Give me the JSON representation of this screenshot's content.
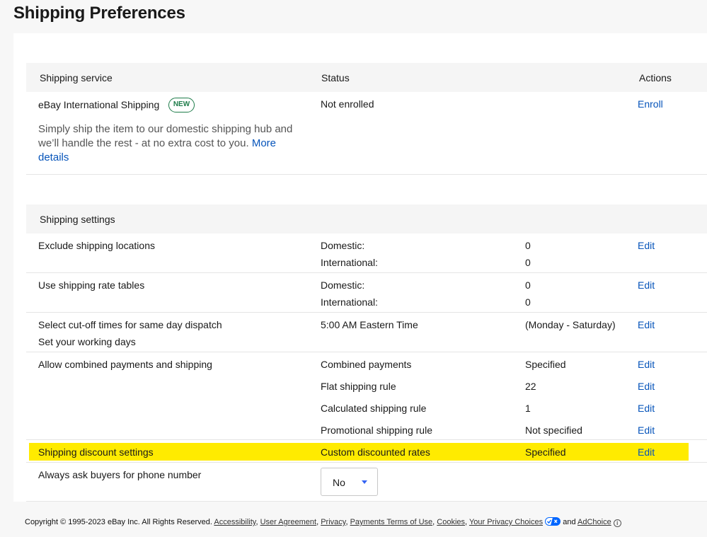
{
  "page": {
    "title": "Shipping Preferences"
  },
  "service_table": {
    "headers": {
      "service": "Shipping service",
      "status": "Status",
      "actions": "Actions"
    },
    "row": {
      "name": "eBay International Shipping",
      "badge": "NEW",
      "description": "Simply ship the item to our domestic shipping hub and we’ll handle the rest - at no extra cost to you.",
      "more_link": "More details",
      "status": "Not enrolled",
      "action": "Enroll"
    }
  },
  "settings": {
    "header": "Shipping settings",
    "exclude": {
      "label": "Exclude shipping locations",
      "domestic_label": "Domestic:",
      "domestic_value": "0",
      "international_label": "International:",
      "international_value": "0",
      "action": "Edit"
    },
    "rate_tables": {
      "label": "Use shipping rate tables",
      "domestic_label": "Domestic:",
      "domestic_value": "0",
      "international_label": "International:",
      "international_value": "0",
      "action": "Edit"
    },
    "cutoff": {
      "label": "Select cut-off times for same day dispatch",
      "sublabel": "Set your working days",
      "time": "5:00 AM Eastern Time",
      "days": "(Monday - Saturday)",
      "action": "Edit"
    },
    "combined": {
      "label": "Allow combined payments and shipping",
      "items": [
        {
          "label": "Combined payments",
          "value": "Specified",
          "action": "Edit"
        },
        {
          "label": "Flat shipping rule",
          "value": "22",
          "action": "Edit"
        },
        {
          "label": "Calculated shipping rule",
          "value": "1",
          "action": "Edit"
        },
        {
          "label": "Promotional shipping rule",
          "value": "Not specified",
          "action": "Edit"
        }
      ]
    },
    "discount": {
      "label": "Shipping discount settings",
      "type": "Custom discounted rates",
      "value": "Specified",
      "action": "Edit"
    },
    "phone": {
      "label": "Always ask buyers for phone number",
      "selected": "No"
    }
  },
  "footer": {
    "copyright": "Copyright © 1995-2023 eBay Inc. All Rights Reserved.",
    "links": [
      "Accessibility",
      "User Agreement",
      "Privacy",
      "Payments Terms of Use",
      "Cookies",
      "Your Privacy Choices"
    ],
    "and": "and",
    "adchoice": "AdChoice"
  },
  "colors": {
    "link": "#0654ba",
    "highlight": "#ffeb00",
    "badge": "#1e7c4a",
    "caret": "#3665f3"
  }
}
